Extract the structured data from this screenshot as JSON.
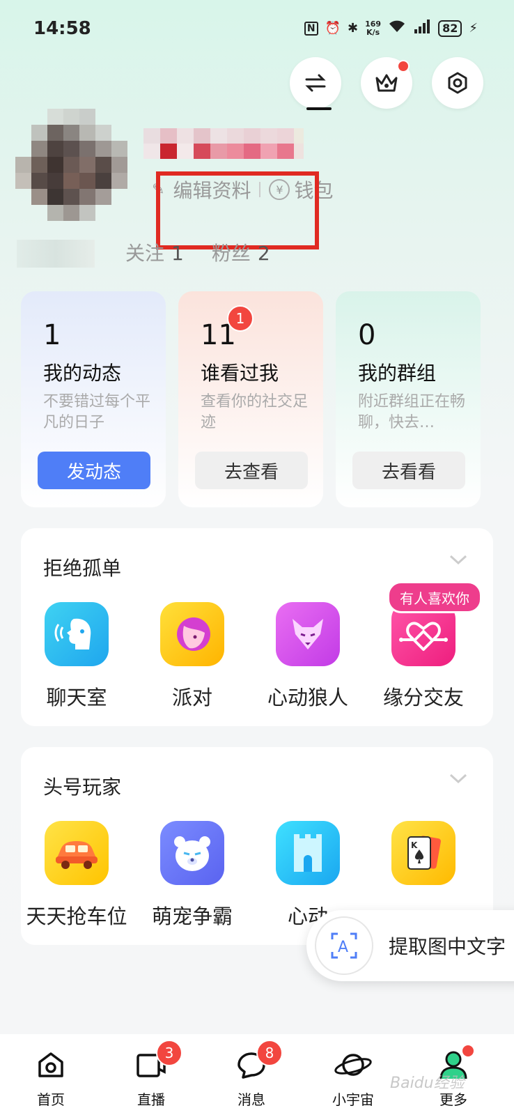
{
  "status_bar": {
    "time": "14:58",
    "speed_top": "169",
    "speed_bottom": "K/s",
    "battery": "82"
  },
  "profile": {
    "edit_label": "编辑资料",
    "wallet_label": "钱包",
    "following_label": "关注",
    "following_count": "1",
    "fans_label": "粉丝",
    "fans_count": "2"
  },
  "cards": [
    {
      "count": "1",
      "title": "我的动态",
      "subtitle": "不要错过每个平凡的日子",
      "button": "发动态"
    },
    {
      "count": "11",
      "badge": "1",
      "title": "谁看过我",
      "subtitle": "查看你的社交足迹",
      "button": "去查看"
    },
    {
      "count": "0",
      "title": "我的群组",
      "subtitle": "附近群组正在畅聊，快去…",
      "button": "去看看"
    }
  ],
  "section1": {
    "title": "拒绝孤单",
    "tag": "有人喜欢你",
    "apps": [
      {
        "label": "聊天室"
      },
      {
        "label": "派对"
      },
      {
        "label": "心动狼人"
      },
      {
        "label": "缘分交友"
      }
    ]
  },
  "section2": {
    "title": "头号玩家",
    "apps": [
      {
        "label": "天天抢车位"
      },
      {
        "label": "萌宠争霸"
      },
      {
        "label": "心动"
      }
    ]
  },
  "ocr": {
    "label": "提取图中文字"
  },
  "nav": {
    "items": [
      {
        "label": "首页"
      },
      {
        "label": "直播",
        "badge": "3"
      },
      {
        "label": "消息",
        "badge": "8"
      },
      {
        "label": "小宇宙"
      },
      {
        "label": "更多"
      }
    ]
  },
  "watermark": "Baidu经验",
  "colors": {
    "primary_button": "#4f7ef7",
    "badge": "#f2463f",
    "highlight_box": "#e02a22"
  }
}
